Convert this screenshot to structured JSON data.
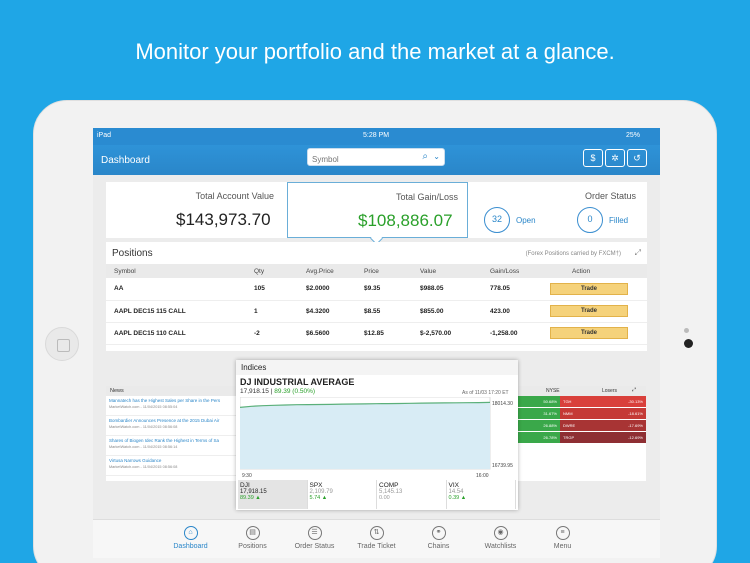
{
  "headline": "Monitor your portfolio and the market at a glance.",
  "status": {
    "carrier": "iPad",
    "time": "5:28 PM",
    "battery": "25%"
  },
  "nav": {
    "title": "Dashboard",
    "symbol_placeholder": "Symbol",
    "icons": [
      "dollar-icon",
      "gear-icon",
      "refresh-icon"
    ],
    "dollar": "$",
    "gear": "✲",
    "refresh": "↺",
    "search": "⌕",
    "chevron": "⌄"
  },
  "summary": {
    "account_label": "Total Account Value",
    "account_value": "$143,973.70",
    "gain_label": "Total Gain/Loss",
    "gain_value": "$108,886.07",
    "order_label": "Order Status",
    "open_count": "32",
    "open_label": "Open",
    "filled_count": "0",
    "filled_label": "Filled"
  },
  "positions": {
    "title": "Positions",
    "note": "(Forex Positions carried by FXCM†)",
    "columns": [
      "Symbol",
      "Qty",
      "Avg.Price",
      "Price",
      "Value",
      "Gain/Loss",
      "Action"
    ],
    "rows": [
      {
        "symbol": "AA",
        "qty": "105",
        "avg": "$2.0000",
        "price": "$9.35",
        "value": "$988.05",
        "gain": "778.05",
        "action": "Trade"
      },
      {
        "symbol": "AAPL DEC15 115 CALL",
        "qty": "1",
        "avg": "$4.3200",
        "price": "$8.55",
        "value": "$855.00",
        "gain": "423.00",
        "action": "Trade"
      },
      {
        "symbol": "AAPL DEC15 110 CALL",
        "qty": "-2",
        "avg": "$6.5600",
        "price": "$12.85",
        "value": "$-2,570.00",
        "gain": "-1,258.00",
        "action": "Trade"
      }
    ]
  },
  "news": {
    "title": "News",
    "items": [
      {
        "t": "Mannatech has the Highest Sales per Share in the Pers",
        "s": "MarketWatch.com - 11/04/2015 08:55:04"
      },
      {
        "t": "Bombardier Announces Presence at the 2015 Dubai Air",
        "s": "MarketWatch.com - 11/04/2015 08:56:08"
      },
      {
        "t": "Shares of Biogen Idec Rank the Highest in Terms of Sa",
        "s": "MarketWatch.com - 11/04/2015 08:56:14"
      },
      {
        "t": "Virtusa Narrows Guidance",
        "s": "MarketWatch.com - 11/04/2015 08:56:08"
      }
    ]
  },
  "movers": {
    "exchange": "NYSE",
    "losers_label": "Losers",
    "rows": [
      {
        "g": "50.68%",
        "sym": "TGH",
        "chg": "-30.13%"
      },
      {
        "g": "31.67%",
        "sym": "NMM",
        "chg": "-18.61%"
      },
      {
        "g": "26.88%",
        "sym": "DWRE",
        "chg": "-17.69%"
      },
      {
        "g": "26.78%",
        "sym": "TRGP",
        "chg": "-12.69%"
      }
    ]
  },
  "indices": {
    "title": "Indices",
    "name": "DJ INDUSTRIAL AVERAGE",
    "value": "17,918.15",
    "change": "89.39 (0.50%)",
    "as_of": "As of 11/03 17:20 ET",
    "high": "18014.30",
    "low": "16739.95",
    "t_start": "9:30",
    "t_end": "16:00",
    "tabs": [
      {
        "name": "DJI",
        "val": "17,918.15",
        "chg": "89.39"
      },
      {
        "name": "SPX",
        "val": "2,109.79",
        "chg": "5.74"
      },
      {
        "name": "COMP",
        "val": "5,145.13",
        "chg": "0.00"
      },
      {
        "name": "VIX",
        "val": "14.54",
        "chg": "0.39"
      }
    ]
  },
  "chart_data": {
    "type": "area",
    "title": "DJ INDUSTRIAL AVERAGE",
    "x": [
      "9:30",
      "16:00"
    ],
    "ylim": [
      16739.95,
      18014.3
    ],
    "values": [
      17830,
      17850,
      17860,
      17868,
      17873,
      17878,
      17880,
      17882,
      17884,
      17888,
      17890,
      17892,
      17895,
      17898,
      17900,
      17903,
      17906,
      17908,
      17910,
      17912,
      17914,
      17916,
      17918
    ],
    "color": "#5bb07a"
  },
  "tabs": [
    {
      "label": "Dashboard",
      "icon": "home-icon",
      "glyph": "⌂",
      "active": true
    },
    {
      "label": "Positions",
      "icon": "positions-icon",
      "glyph": "▤"
    },
    {
      "label": "Order Status",
      "icon": "order-status-icon",
      "glyph": "☰"
    },
    {
      "label": "Trade Ticket",
      "icon": "trade-ticket-icon",
      "glyph": "⇅"
    },
    {
      "label": "Chains",
      "icon": "chains-icon",
      "glyph": "⚭"
    },
    {
      "label": "Watchlists",
      "icon": "watchlists-icon",
      "glyph": "◉"
    },
    {
      "label": "Menu",
      "icon": "menu-icon",
      "glyph": "≡"
    }
  ]
}
